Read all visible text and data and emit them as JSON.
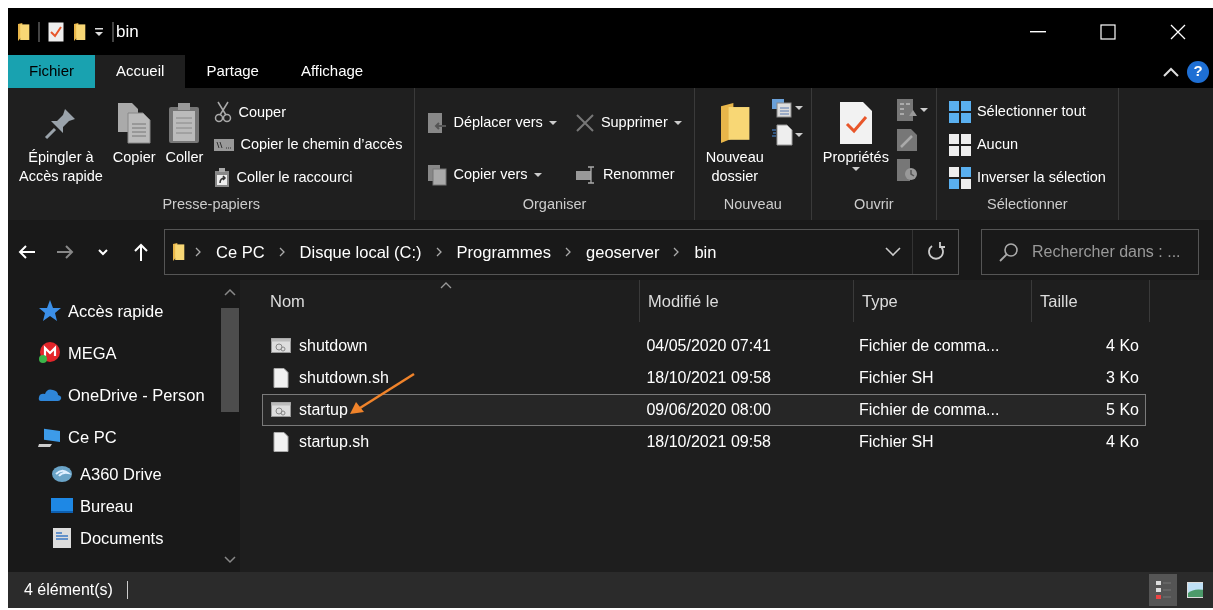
{
  "window": {
    "title": "bin",
    "help": "?"
  },
  "ribbon_tabs": [
    {
      "label": "Fichier",
      "kind": "file",
      "selected": false
    },
    {
      "label": "Accueil",
      "kind": "tab",
      "selected": true
    },
    {
      "label": "Partage",
      "kind": "tab",
      "selected": false
    },
    {
      "label": "Affichage",
      "kind": "tab",
      "selected": false
    }
  ],
  "ribbon_groups": [
    {
      "label": "Presse-papiers",
      "items": [
        {
          "kind": "large",
          "label": "Épingler à\nAccès rapide",
          "has_menu": false
        },
        {
          "kind": "large",
          "label": "Copier",
          "has_menu": false
        },
        {
          "kind": "large",
          "label": "Coller",
          "has_menu": false
        },
        {
          "kind": "small",
          "label": "Couper",
          "has_menu": false
        },
        {
          "kind": "small",
          "label": "Copier le chemin d’accès",
          "has_menu": false
        },
        {
          "kind": "small",
          "label": "Coller le raccourci",
          "has_menu": false
        }
      ]
    },
    {
      "label": "Organiser",
      "items": [
        {
          "kind": "small",
          "label": "Déplacer vers",
          "has_menu": true
        },
        {
          "kind": "small",
          "label": "Copier vers",
          "has_menu": true
        },
        {
          "kind": "small",
          "label": "Supprimer",
          "has_menu": true
        },
        {
          "kind": "small",
          "label": "Renommer",
          "has_menu": false
        }
      ]
    },
    {
      "label": "Nouveau",
      "items": [
        {
          "kind": "large",
          "label": "Nouveau\ndossier",
          "has_menu": false
        },
        {
          "kind": "icon",
          "has_menu": true
        },
        {
          "kind": "icon",
          "has_menu": true
        }
      ]
    },
    {
      "label": "Ouvrir",
      "items": [
        {
          "kind": "large",
          "label": "Propriétés",
          "has_menu": true
        },
        {
          "kind": "icon",
          "has_menu": true
        },
        {
          "kind": "icon",
          "has_menu": false
        },
        {
          "kind": "icon",
          "has_menu": false
        }
      ]
    },
    {
      "label": "Sélectionner",
      "items": [
        {
          "kind": "small",
          "label": "Sélectionner tout",
          "has_menu": false
        },
        {
          "kind": "small",
          "label": "Aucun",
          "has_menu": false
        },
        {
          "kind": "small",
          "label": "Inverser la sélection",
          "has_menu": false
        }
      ]
    }
  ],
  "address": {
    "path": [
      "Ce PC",
      "Disque local (C:)",
      "Programmes",
      "geoserver",
      "bin"
    ]
  },
  "search": {
    "placeholder": "Rechercher dans : ..."
  },
  "sidebar": {
    "items": [
      {
        "label": "Accès rapide"
      },
      {
        "label": "MEGA"
      },
      {
        "label": "OneDrive - Person"
      },
      {
        "label": "Ce PC",
        "children": [
          {
            "label": "A360 Drive"
          },
          {
            "label": "Bureau"
          },
          {
            "label": "Documents"
          }
        ]
      }
    ]
  },
  "table": {
    "columns": [
      {
        "label": "Nom",
        "sorted": true
      },
      {
        "label": "Modifié le",
        "sorted": false
      },
      {
        "label": "Type",
        "sorted": false
      },
      {
        "label": "Taille",
        "sorted": false
      }
    ],
    "rows": [
      {
        "kind": "script",
        "selected": false,
        "cells": [
          "shutdown",
          "04/05/2020 07:41",
          "Fichier de comma...",
          "4 Ko"
        ]
      },
      {
        "kind": "file",
        "selected": false,
        "cells": [
          "shutdown.sh",
          "18/10/2021 09:58",
          "Fichier SH",
          "3 Ko"
        ]
      },
      {
        "kind": "script",
        "selected": true,
        "cells": [
          "startup",
          "09/06/2020 08:00",
          "Fichier de comma...",
          "5 Ko"
        ]
      },
      {
        "kind": "file",
        "selected": false,
        "cells": [
          "startup.sh",
          "18/10/2021 09:58",
          "Fichier SH",
          "4 Ko"
        ]
      }
    ]
  },
  "status_bar": {
    "text": "4 élément(s)",
    "views": [
      {
        "selected": true
      },
      {
        "selected": false
      }
    ]
  }
}
